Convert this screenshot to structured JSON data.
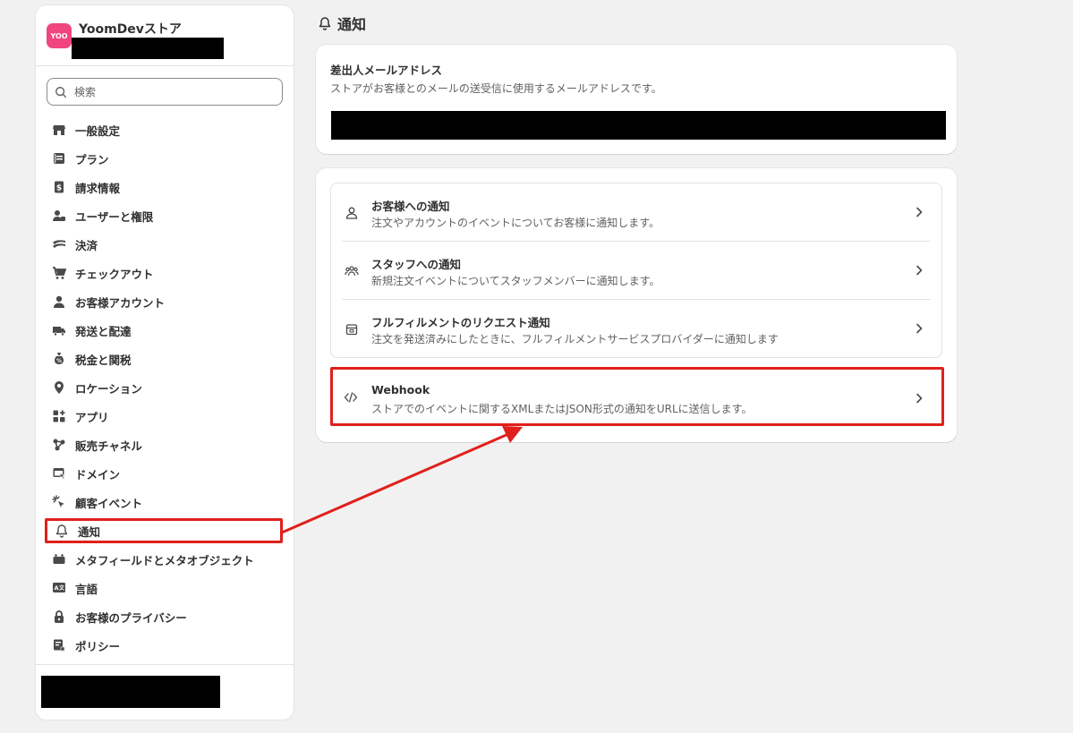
{
  "store": {
    "avatar_text": "YOO",
    "name": "YoomDevストア"
  },
  "search": {
    "placeholder": "検索"
  },
  "nav": {
    "items": [
      {
        "label": "一般設定"
      },
      {
        "label": "プラン"
      },
      {
        "label": "請求情報"
      },
      {
        "label": "ユーザーと権限"
      },
      {
        "label": "決済"
      },
      {
        "label": "チェックアウト"
      },
      {
        "label": "お客様アカウント"
      },
      {
        "label": "発送と配達"
      },
      {
        "label": "税金と関税"
      },
      {
        "label": "ロケーション"
      },
      {
        "label": "アプリ"
      },
      {
        "label": "販売チャネル"
      },
      {
        "label": "ドメイン"
      },
      {
        "label": "顧客イベント"
      },
      {
        "label": "通知"
      },
      {
        "label": "メタフィールドとメタオブジェクト"
      },
      {
        "label": "言語"
      },
      {
        "label": "お客様のプライバシー"
      },
      {
        "label": "ポリシー"
      }
    ]
  },
  "page": {
    "title": "通知"
  },
  "sender": {
    "title": "差出人メールアドレス",
    "description": "ストアがお客様とのメールの送受信に使用するメールアドレスです。"
  },
  "notifications": {
    "rows": [
      {
        "title": "お客様への通知",
        "description": "注文やアカウントのイベントについてお客様に通知します。"
      },
      {
        "title": "スタッフへの通知",
        "description": "新規注文イベントについてスタッフメンバーに通知します。"
      },
      {
        "title": "フルフィルメントのリクエスト通知",
        "description": "注文を発送済みにしたときに、フルフィルメントサービスプロバイダーに通知します"
      }
    ],
    "webhook": {
      "title": "Webhook",
      "description": "ストアでのイベントに関するXMLまたはJSON形式の通知をURLに送信します。"
    }
  },
  "colors": {
    "highlight": "#e0201c",
    "avatar": "#f0457e"
  }
}
